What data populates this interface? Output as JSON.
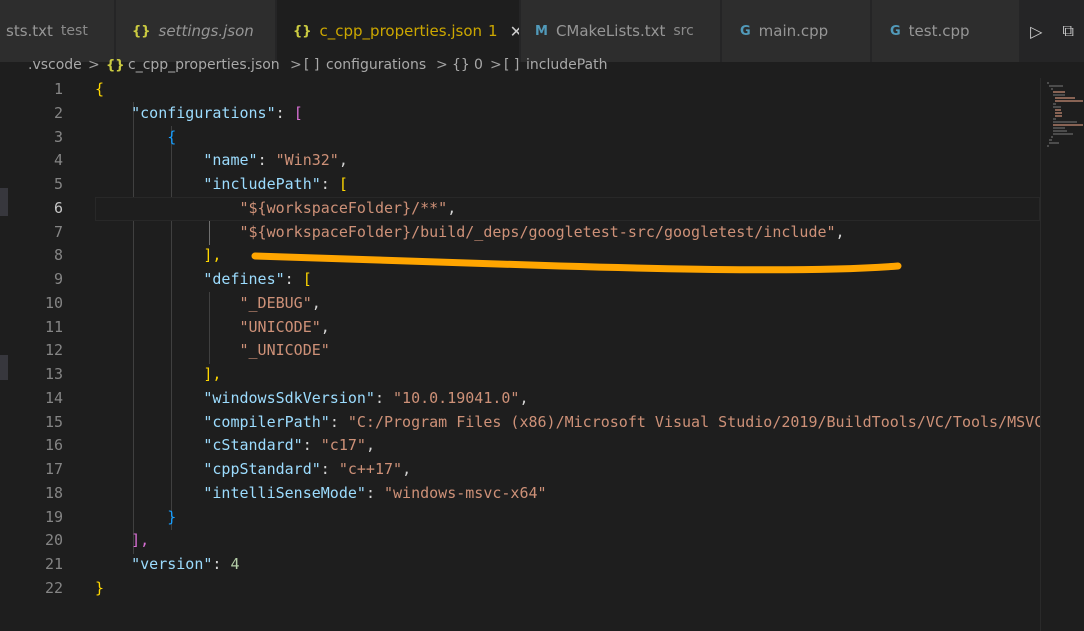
{
  "tabs": [
    {
      "label": "sts.txt",
      "suffix": "test",
      "icon": "",
      "italic": false,
      "active": false
    },
    {
      "label": "settings.json",
      "suffix": "",
      "icon": "{}",
      "italic": true,
      "active": false
    },
    {
      "label": "c_cpp_properties.json",
      "suffix": "",
      "icon": "{}",
      "italic": false,
      "active": true,
      "modified_count": "1",
      "close": "✕"
    },
    {
      "label": "CMakeLists.txt",
      "suffix": "src",
      "icon": "M",
      "italic": false,
      "active": false
    },
    {
      "label": "main.cpp",
      "suffix": "",
      "icon": "G",
      "italic": false,
      "active": false
    },
    {
      "label": "test.cpp",
      "suffix": "",
      "icon": "G",
      "italic": false,
      "active": false
    }
  ],
  "editor_actions": {
    "run": "▷",
    "split": "⧉"
  },
  "breadcrumb": [
    ".vscode",
    "{}",
    "c_cpp_properties.json",
    "[ ]",
    "configurations",
    "{}",
    "0",
    "[ ]",
    "includePath"
  ],
  "breadcrumb_sep": ">",
  "line_numbers": [
    "1",
    "2",
    "3",
    "4",
    "5",
    "6",
    "7",
    "8",
    "9",
    "10",
    "11",
    "12",
    "13",
    "14",
    "15",
    "16",
    "17",
    "18",
    "19",
    "20",
    "21",
    "22"
  ],
  "code": {
    "l1": "{",
    "l2_key": "\"configurations\"",
    "l2_colon": ": ",
    "l2_br": "[",
    "l3": "{",
    "l4_key": "\"name\"",
    "l4_val": "\"Win32\"",
    "l5_key": "\"includePath\"",
    "l5_br": "[",
    "l6_val": "\"${workspaceFolder}/**\"",
    "l7_val": "\"${workspaceFolder}/build/_deps/googletest-src/googletest/include\"",
    "l8": "],",
    "l9_key": "\"defines\"",
    "l9_br": "[",
    "l10_val": "\"_DEBUG\"",
    "l11_val": "\"UNICODE\"",
    "l12_val": "\"_UNICODE\"",
    "l13": "],",
    "l14_key": "\"windowsSdkVersion\"",
    "l14_val": "\"10.0.19041.0\"",
    "l15_key": "\"compilerPath\"",
    "l15_val": "\"C:/Program Files (x86)/Microsoft Visual Studio/2019/BuildTools/VC/Tools/MSVC\"",
    "l16_key": "\"cStandard\"",
    "l16_val": "\"c17\"",
    "l17_key": "\"cppStandard\"",
    "l17_val": "\"c++17\"",
    "l18_key": "\"intelliSenseMode\"",
    "l18_val": "\"windows-msvc-x64\"",
    "l19": "}",
    "l20": "],",
    "l21_key": "\"version\"",
    "l21_val": "4",
    "l22": "}"
  },
  "colors": {
    "annotation_underline": "#ffa500",
    "editor_bg": "#1e1e1e"
  }
}
